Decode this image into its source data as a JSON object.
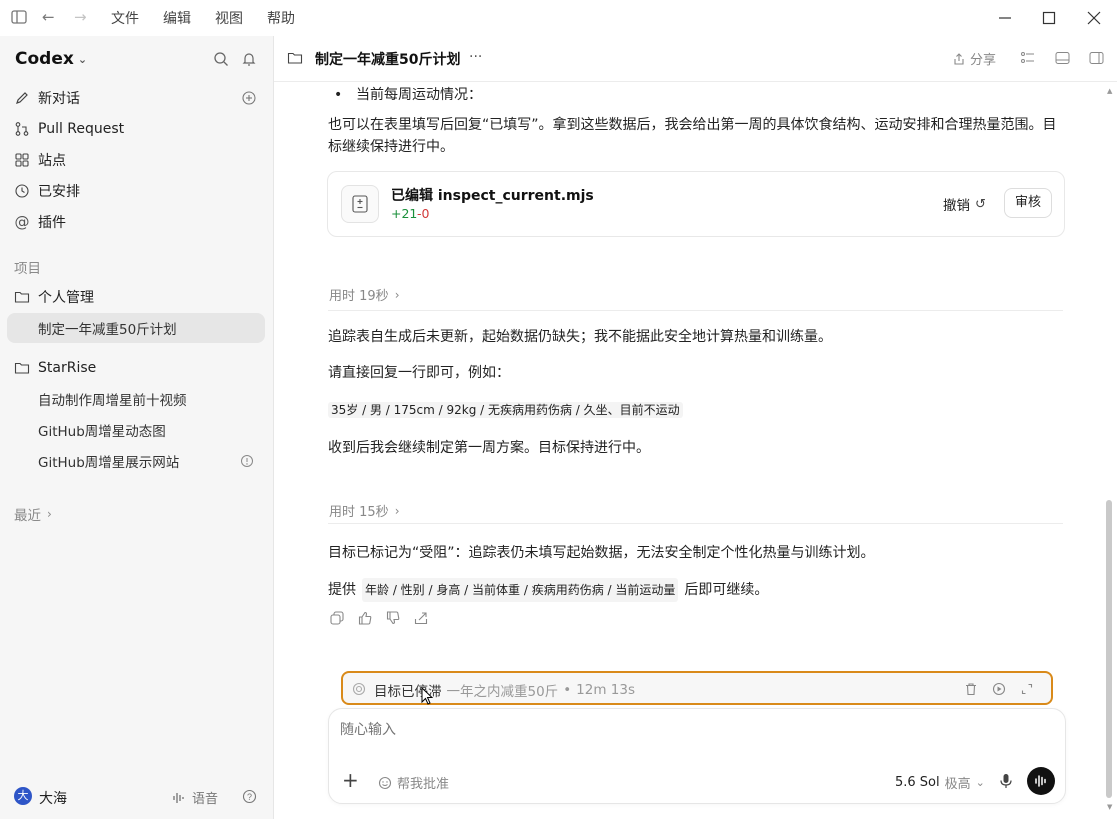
{
  "menu": {
    "file": "文件",
    "edit": "编辑",
    "view": "视图",
    "help": "帮助"
  },
  "sidebar": {
    "app_name": "Codex",
    "items": [
      {
        "label": "新对话"
      },
      {
        "label": "Pull Request"
      },
      {
        "label": "站点"
      },
      {
        "label": "已安排"
      },
      {
        "label": "插件"
      }
    ],
    "projects_label": "项目",
    "project1": {
      "name": "个人管理",
      "threads": [
        {
          "label": "制定一年减重50斤计划"
        }
      ]
    },
    "project2": {
      "name": "StarRise",
      "threads": [
        {
          "label": "自动制作周增星前十视频"
        },
        {
          "label": "GitHub周增星动态图"
        },
        {
          "label": "GitHub周增星展示网站"
        }
      ]
    },
    "recent_label": "最近",
    "user": {
      "name": "大海",
      "avatar_char": "大"
    },
    "voice_label": "语音"
  },
  "header": {
    "title": "制定一年减重50斤计划",
    "more": "···",
    "share_label": "分享"
  },
  "chat": {
    "bullet_item": "当前每周运动情况：",
    "para1": "也可以在表里填写后回复“已填写”。拿到这些数据后，我会给出第一周的具体饮食结构、运动安排和合理热量范围。目标继续保持进行中。",
    "edit_card": {
      "title": "已编辑 inspect_current.mjs",
      "added": "+21",
      "removed": "-0",
      "undo_label": "撤销",
      "review_label": "审核"
    },
    "time1": "用时 19秒",
    "para2": "追踪表自生成后未更新，起始数据仍缺失；我不能据此安全地计算热量和训练量。",
    "para3": "请直接回复一行即可，例如：",
    "example_code": "35岁 / 男 / 175cm / 92kg / 无疾病用药伤病 / 久坐、目前不运动",
    "para4": "收到后我会继续制定第一周方案。目标保持进行中。",
    "time2": "用时 15秒",
    "para5": "目标已标记为“受阻”：追踪表仍未填写起始数据，无法安全制定个性化热量与训练计划。",
    "para6_prefix": "提供",
    "para6_code": "年龄 / 性别 / 身高 / 当前体重 / 疾病用药伤病 / 当前运动量",
    "para6_suffix": "后即可继续。"
  },
  "goal_bar": {
    "status": "目标已停滞",
    "goal": "一年之内减重50斤",
    "separator": "•",
    "duration": "12m 13s"
  },
  "composer": {
    "placeholder": "随心输入",
    "approve_label": "帮我批准",
    "model": "5.6 Sol",
    "effort": "极高"
  },
  "colors": {
    "goal_border": "#d98a1a",
    "added": "#1a8f3a",
    "removed": "#d23a3a"
  }
}
